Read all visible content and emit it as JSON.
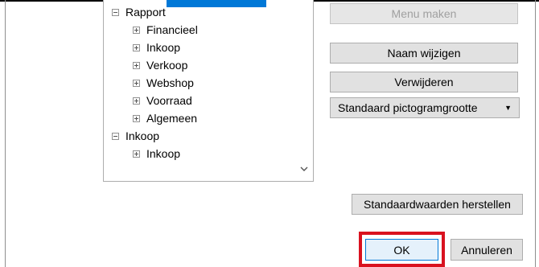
{
  "tree": {
    "nodes": [
      {
        "label": "Rapport",
        "expanded": true,
        "level": 0
      },
      {
        "label": "Financieel",
        "expanded": false,
        "level": 1
      },
      {
        "label": "Inkoop",
        "expanded": false,
        "level": 1
      },
      {
        "label": "Verkoop",
        "expanded": false,
        "level": 1
      },
      {
        "label": "Webshop",
        "expanded": false,
        "level": 1
      },
      {
        "label": "Voorraad",
        "expanded": false,
        "level": 1
      },
      {
        "label": "Algemeen",
        "expanded": false,
        "level": 1
      },
      {
        "label": "Inkoop",
        "expanded": true,
        "level": 0
      },
      {
        "label": "Inkoop",
        "expanded": false,
        "level": 1
      }
    ],
    "scroll_down_glyph": "⌄"
  },
  "buttons": {
    "menu_maken": "Menu maken",
    "naam_wijzigen": "Naam wijzigen",
    "verwijderen": "Verwijderen",
    "standaard_pictogramgrootte": "Standaard pictogramgrootte",
    "standaardwaarden_herstellen": "Standaardwaarden herstellen",
    "ok": "OK",
    "annuleren": "Annuleren"
  },
  "colors": {
    "selection": "#0078d7",
    "highlight": "#d9121f"
  }
}
